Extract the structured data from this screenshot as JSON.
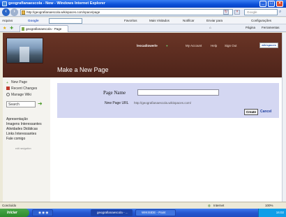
{
  "window": {
    "title": "geografianaescola - New - Windows Internet Explorer"
  },
  "nav": {
    "url": "http://geografianaescola.wikispaces.com/space/page",
    "search_placeholder": "Google"
  },
  "menubar": {
    "arquivo": "Arquivo",
    "google": "Google",
    "favorites": "Favoritos",
    "mais_visitados": "Mais Visitados",
    "notificar": "Notificar",
    "enviar": "Enviar para",
    "config": "Configurações"
  },
  "tab": {
    "title": "geografianaescola - Page"
  },
  "tabtools": {
    "pagina": "Página",
    "ferramentas": "Ferramentas"
  },
  "header": {
    "username": "leocadiowerle",
    "my_account": "My Account",
    "help": "Help",
    "sign_out": "Sign Out",
    "badge": "wikispaces",
    "heading": "Make a New Page"
  },
  "sidebar": {
    "new_page": "New Page",
    "recent_changes": "Recent Changes",
    "manage_wiki": "Manage Wiki",
    "search_value": "Search",
    "nav_items": [
      "Apresentação",
      "Imagens Interessantes",
      "Atividades Didáticas",
      "Links Interessantes",
      "Fale comigo"
    ],
    "edit_navigation": "edit navigation"
  },
  "form": {
    "page_name_label": "Page Name",
    "page_name_value": "",
    "page_url_label": "New Page URL",
    "page_url_value": "http://geografianaescola.wikispaces.com/",
    "create_label": "Create",
    "cancel_label": "Cancel"
  },
  "status": {
    "left": "Concluído",
    "zone": "Internet",
    "zoom": "100%"
  },
  "taskbar": {
    "start": "Iniciar",
    "task1": "geografianaescola - ...",
    "task2": "WIKISIDE - Paint",
    "clock": "16:02"
  },
  "colors": {
    "header_brown": "#5a2b20",
    "form_panel": "#D4D7F2",
    "cancel_link": "#2040a0"
  }
}
